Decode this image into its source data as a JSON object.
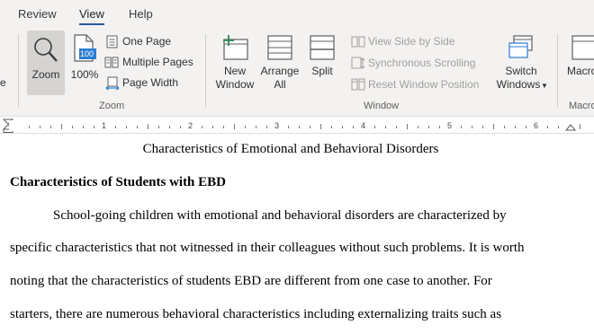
{
  "ribbon_tabs": [
    "Review",
    "View",
    "Help"
  ],
  "active_tab": "View",
  "zoom_group": {
    "zoom_label": "Zoom",
    "percent_label": "100%",
    "percent_icon_text": "100",
    "one_page": "One Page",
    "multiple_pages": "Multiple Pages",
    "page_width": "Page Width",
    "group_label": "Zoom"
  },
  "window_group": {
    "new_window_line1": "New",
    "new_window_line2": "Window",
    "arrange_all_line1": "Arrange",
    "arrange_all_line2": "All",
    "split": "Split",
    "view_side_by_side": "View Side by Side",
    "synchronous_scrolling": "Synchronous Scrolling",
    "reset_window_position": "Reset Window Position",
    "switch_windows_line1": "Switch",
    "switch_windows_line2": "Windows",
    "group_label": "Window"
  },
  "macros_group": {
    "label": "Macro",
    "group_label": "Macro"
  },
  "left_partial_label": "e",
  "ruler_numbers": [
    "1",
    "2",
    "3",
    "4",
    "5",
    "6"
  ],
  "document": {
    "title": "Characteristics of Emotional and Behavioral Disorders",
    "heading": "Characteristics of Students with EBD",
    "lines": [
      "School-going children with emotional and behavioral disorders are characterized by",
      "specific characteristics that not witnessed in their colleagues without such problems. It is worth",
      "noting that the characteristics of students EBD are different from one case to another. For",
      "starters, there are numerous behavioral characteristics including externalizing traits such as"
    ]
  },
  "colors": {
    "accent": "#2b579a",
    "ribbon_bg": "#f3f2f1",
    "icon_blue": "#2b7cd3",
    "icon_green": "#2e8b57"
  }
}
